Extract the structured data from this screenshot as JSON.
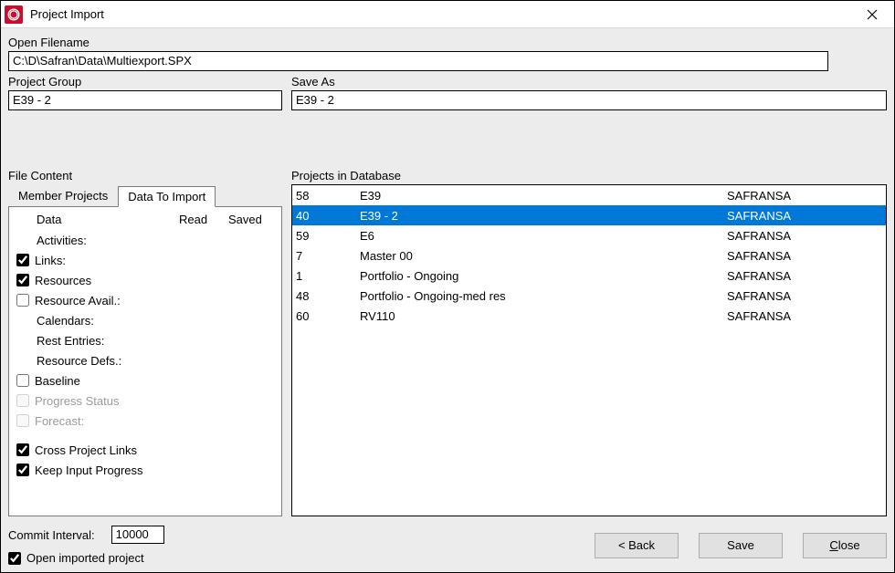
{
  "window": {
    "title": "Project Import"
  },
  "open_filename": {
    "label": "Open Filename",
    "value": "C:\\D\\Safran\\Data\\Multiexport.SPX"
  },
  "project_group": {
    "label": "Project Group",
    "value": "E39 - 2"
  },
  "save_as": {
    "label": "Save As",
    "value": "E39 - 2"
  },
  "file_content_label": "File Content",
  "projects_db_label": "Projects in Database",
  "tabs": {
    "member": "Member Projects",
    "data": "Data To Import"
  },
  "columns": {
    "data": "Data",
    "read": "Read",
    "saved": "Saved"
  },
  "checks": {
    "activities": "Activities:",
    "links": "Links:",
    "resources": "Resources",
    "resource_avail": "Resource Avail.:",
    "calendars": "Calendars:",
    "rest_entries": "Rest Entries:",
    "resource_defs": "Resource Defs.:",
    "baseline": "Baseline",
    "progress_status": "Progress Status",
    "forecast": "Forecast:",
    "cross_project_links": "Cross Project Links",
    "keep_input_progress": "Keep Input Progress"
  },
  "projects": [
    {
      "id": "58",
      "name": "E39",
      "owner": "SAFRANSA"
    },
    {
      "id": "40",
      "name": "E39 - 2",
      "owner": "SAFRANSA"
    },
    {
      "id": "59",
      "name": "E6",
      "owner": "SAFRANSA"
    },
    {
      "id": "7",
      "name": "Master 00",
      "owner": "SAFRANSA"
    },
    {
      "id": "1",
      "name": "Portfolio - Ongoing",
      "owner": "SAFRANSA"
    },
    {
      "id": "48",
      "name": "Portfolio - Ongoing-med res",
      "owner": "SAFRANSA"
    },
    {
      "id": "60",
      "name": "RV110",
      "owner": "SAFRANSA"
    }
  ],
  "selected_project_index": 1,
  "commit": {
    "label": "Commit Interval:",
    "value": "10000"
  },
  "open_imported_label": "Open imported project",
  "buttons": {
    "back": "< Back",
    "save": "Save",
    "close_prefix": "C",
    "close_rest": "lose"
  }
}
